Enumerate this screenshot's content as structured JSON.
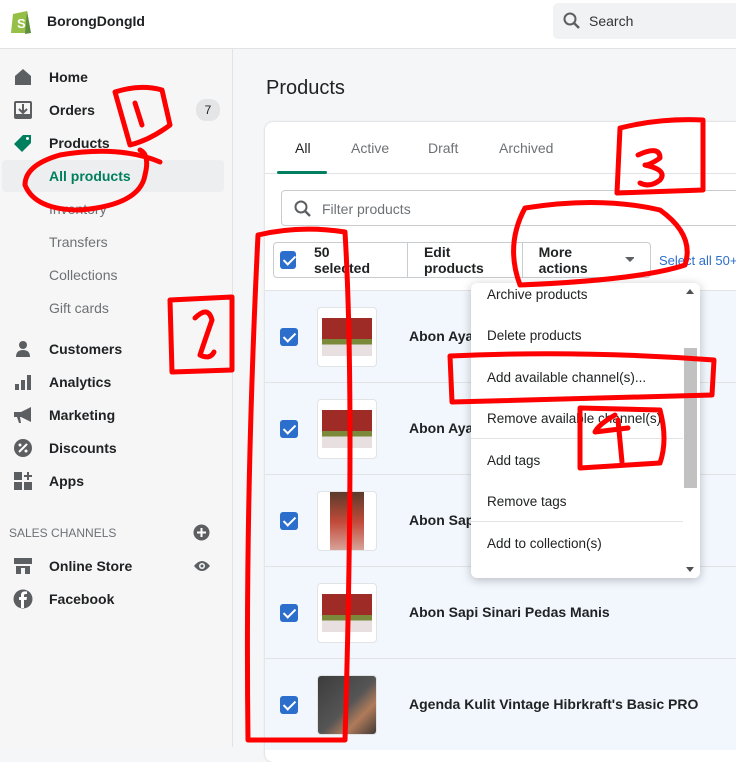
{
  "topbar": {
    "store_name": "BorongDongId",
    "search_placeholder": "Search"
  },
  "sidebar": {
    "items": [
      {
        "label": "Home",
        "icon": "home-icon"
      },
      {
        "label": "Orders",
        "icon": "orders-icon",
        "badge": "7"
      },
      {
        "label": "Products",
        "icon": "tag-icon"
      }
    ],
    "product_sub": [
      "All products",
      "Inventory",
      "Transfers",
      "Collections",
      "Gift cards"
    ],
    "items2": [
      {
        "label": "Customers",
        "icon": "person-icon"
      },
      {
        "label": "Analytics",
        "icon": "bar-chart-icon"
      },
      {
        "label": "Marketing",
        "icon": "megaphone-icon"
      },
      {
        "label": "Discounts",
        "icon": "discount-icon"
      },
      {
        "label": "Apps",
        "icon": "apps-icon"
      }
    ],
    "sales_channels_label": "SALES CHANNELS",
    "channels": [
      {
        "label": "Online Store",
        "icon": "store-icon"
      },
      {
        "label": "Facebook",
        "icon": "facebook-icon"
      }
    ]
  },
  "main": {
    "title": "Products",
    "tabs": [
      "All",
      "Active",
      "Draft",
      "Archived"
    ],
    "filter_placeholder": "Filter products",
    "bulk": {
      "selected": "50 selected",
      "edit": "Edit products",
      "more": "More actions",
      "select_all": "Select all 50+"
    },
    "products": [
      "Abon Ayam",
      "Abon Ayam",
      "Abon Sapi",
      "Abon Sapi Sinari Pedas Manis",
      "Agenda Kulit Vintage Hibrkraft's Basic PRO"
    ],
    "menu": [
      "Archive products",
      "Delete products",
      "Add available channel(s)...",
      "Remove available channel(s)",
      "Add tags",
      "Remove tags",
      "Add to collection(s)"
    ]
  },
  "colors": {
    "accent": "#008060",
    "selected_checkbox": "#2c6ecb",
    "annotation": "#ff0000"
  }
}
